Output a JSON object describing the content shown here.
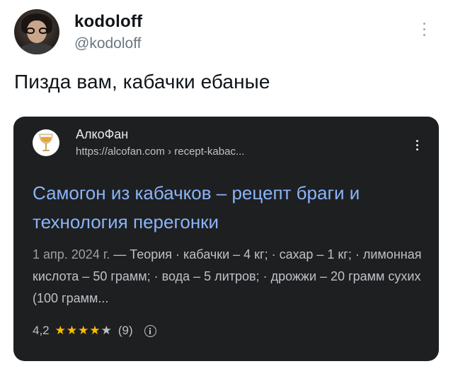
{
  "author": {
    "display_name": "kodoloff",
    "handle": "@kodoloff",
    "avatar_icon": "user-avatar"
  },
  "tweet": {
    "text": "Пизда вам, кабачки ебаные"
  },
  "card": {
    "site_name": "АлкоФан",
    "site_url": "https://alcofan.com › recept-kabac...",
    "site_icon": "wine-glass-icon",
    "title": "Самогон из кабачков – рецепт браги и технология перегонки",
    "date": "1 апр. 2024 г.",
    "snippet": " — Теория · кабачки – 4 кг; · сахар – 1 кг; · лимонная кислота – 50 грамм; · вода – 5 литров; · дрожжи – 20 грамм сухих (100 грамм...",
    "rating_value": "4,2",
    "rating_stars": 4.2,
    "stars_full": "★★★★",
    "stars_empty": "★",
    "rating_count": "(9)"
  },
  "colors": {
    "card_background": "#1e1f21",
    "link_blue": "#8ab4f8",
    "star_yellow": "#fbbc04",
    "handle_gray": "#6b7780"
  }
}
